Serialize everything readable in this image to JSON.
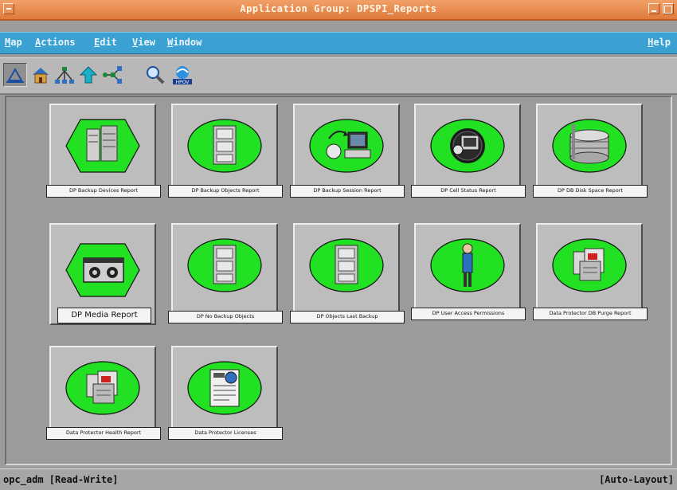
{
  "window": {
    "title": "Application Group: DPSPI_Reports"
  },
  "menubar": {
    "items": [
      {
        "label": "Map",
        "mnemonic": "M"
      },
      {
        "label": "Actions",
        "mnemonic": "A"
      },
      {
        "label": "Edit",
        "mnemonic": "E"
      },
      {
        "label": "View",
        "mnemonic": "V"
      },
      {
        "label": "Window",
        "mnemonic": "W"
      }
    ],
    "help": "Help"
  },
  "toolbar": {
    "buttons": [
      {
        "icon": "triangle-home-icon",
        "pressed": true
      },
      {
        "icon": "house-icon",
        "pressed": false
      },
      {
        "icon": "hierarchy-icon",
        "pressed": false
      },
      {
        "icon": "up-arrow-icon",
        "pressed": false
      },
      {
        "icon": "network-icon",
        "pressed": false
      },
      {
        "icon": "magnifier-icon",
        "pressed": false
      },
      {
        "icon": "hpov-logo-icon",
        "pressed": false
      }
    ]
  },
  "tiles": [
    {
      "label": "DP Backup Devices Report",
      "icon": "server-icon",
      "shape": "hexagon"
    },
    {
      "label": "DP Backup Objects Report",
      "icon": "filing-cabinet-icon",
      "shape": "ellipse"
    },
    {
      "label": "DP Backup Session Report",
      "icon": "backup-session-icon",
      "shape": "ellipse"
    },
    {
      "label": "DP Cell Status Report",
      "icon": "cell-status-icon",
      "shape": "ellipse"
    },
    {
      "label": "DP DB Disk Space Report",
      "icon": "disk-stack-icon",
      "shape": "ellipse"
    },
    {
      "label": "DP Media Report",
      "icon": "tape-cartridge-icon",
      "shape": "hexagon"
    },
    {
      "label": "DP No Backup Objects",
      "icon": "filing-cabinet-icon",
      "shape": "ellipse"
    },
    {
      "label": "DP Objects Last Backup",
      "icon": "filing-cabinet-icon",
      "shape": "ellipse"
    },
    {
      "label": "DP User Access Permissions",
      "icon": "user-figure-icon",
      "shape": "ellipse"
    },
    {
      "label": "Data Protector DB Purge Report",
      "icon": "report-docs-icon",
      "shape": "ellipse"
    },
    {
      "label": "Data Protector Health Report",
      "icon": "report-docs-icon",
      "shape": "ellipse"
    },
    {
      "label": "Data Protector Licenses",
      "icon": "license-icon",
      "shape": "ellipse"
    }
  ],
  "statusbar": {
    "left": "opc_adm [Read-Write]",
    "right": "[Auto-Layout]"
  },
  "colors": {
    "titlebar": "#e07a3c",
    "menubar": "#3ba0d2",
    "symbol_green": "#22e022"
  }
}
